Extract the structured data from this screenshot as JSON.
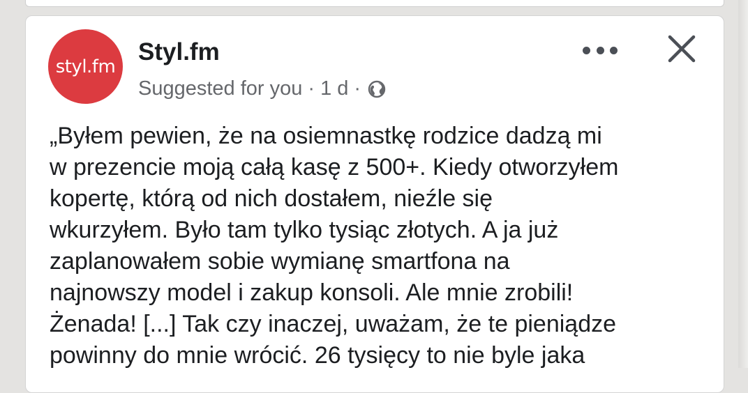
{
  "post": {
    "avatar_text": "styl.fm",
    "page_name": "Styl.fm",
    "suggested": "Suggested for you",
    "separator": "·",
    "time": "1 d",
    "text_lines": [
      "„Byłem pewien, że na osiemnastkę rodzice dadzą mi",
      "w prezencie moją całą kasę z 500+. Kiedy otworzyłem",
      "kopertę, którą od nich dostałem, nieźle się",
      "wkurzyłem. Było tam tylko tysiąc złotych. A ja już",
      "zaplanowałem sobie wymianę smartfona na",
      "najnowszy model i zakup konsoli. Ale mnie zrobili!",
      "Żenada! [...] Tak czy inaczej, uważam, że te pieniądze",
      "powinny do mnie wrócić. 26 tysięcy to nie byle jaka"
    ]
  },
  "icons": {
    "more": "more-options-icon",
    "close": "close-icon",
    "audience": "globe-icon"
  },
  "colors": {
    "brand_red": "#dc3b40",
    "text": "#1c1e21",
    "secondary_text": "#65676b",
    "background": "#e4e3e1"
  }
}
